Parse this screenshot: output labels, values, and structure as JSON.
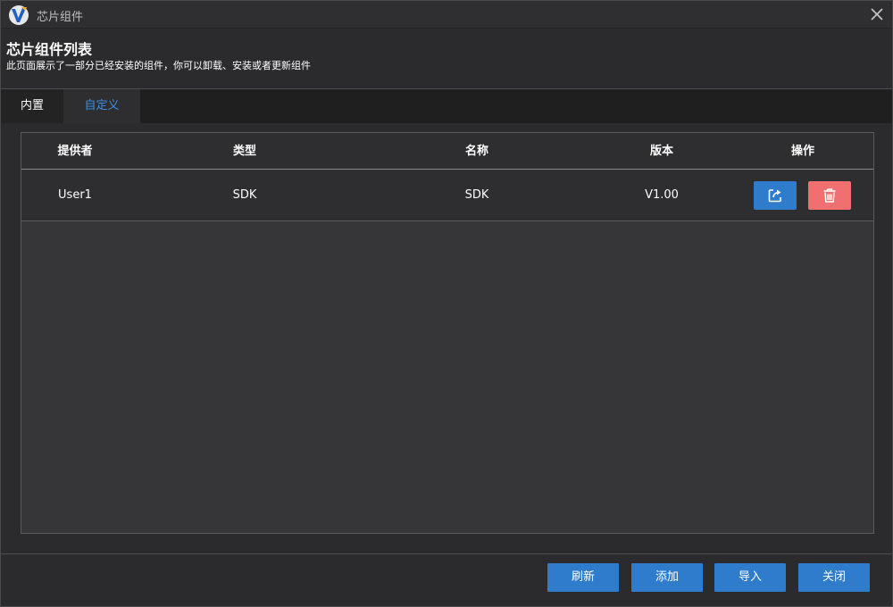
{
  "window": {
    "title": "芯片组件",
    "icons": {
      "logo": "app-logo-icon",
      "close": "close-icon"
    }
  },
  "header": {
    "title": "芯片组件列表",
    "description": "此页面展示了一部分已经安装的组件，你可以卸载、安装或者更新组件"
  },
  "tabs": [
    {
      "label": "内置",
      "active": false
    },
    {
      "label": "自定义",
      "active": true
    }
  ],
  "table": {
    "columns": [
      "提供者",
      "类型",
      "名称",
      "版本",
      "操作"
    ],
    "rows": [
      {
        "provider": "User1",
        "type": "SDK",
        "name": "SDK",
        "version": "V1.00",
        "actions": [
          "edit-export-icon",
          "trash-icon"
        ]
      }
    ]
  },
  "footer": {
    "refresh_label": "刷新",
    "add_label": "添加",
    "import_label": "导入",
    "close_label": "关闭"
  },
  "colors": {
    "accent": "#2f7ccd",
    "danger": "#f07072",
    "active_tab_text": "#3b8fe0",
    "background": "#2b2b2d"
  }
}
